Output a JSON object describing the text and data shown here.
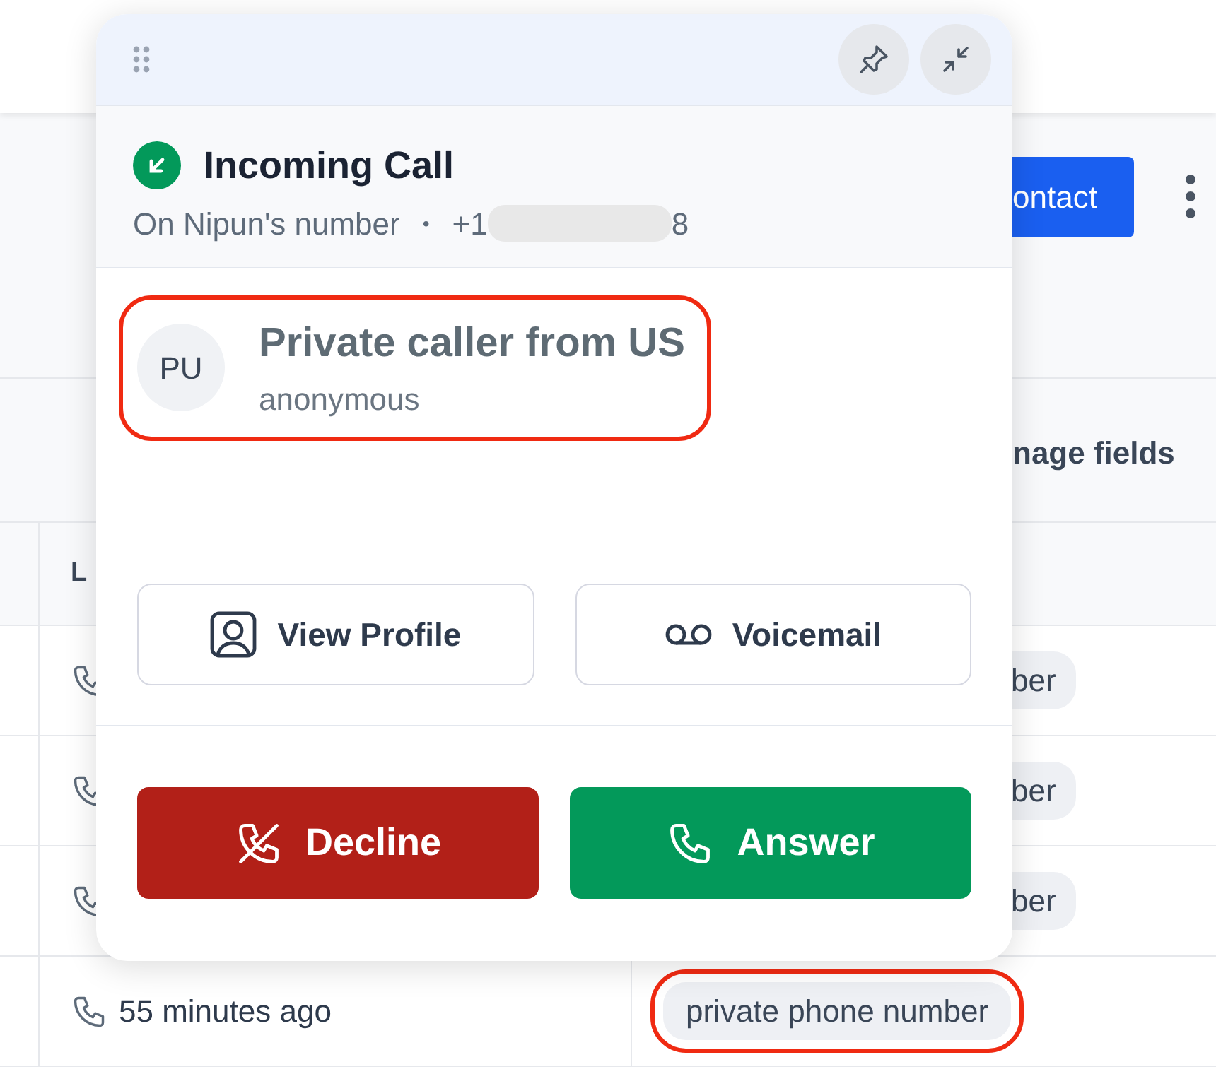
{
  "page": {
    "header_button": "ontact",
    "manage_fields": "nage fields",
    "table": {
      "column_header": "L",
      "rows": [
        {
          "tag": "ber",
          "highlighted": false
        },
        {
          "tag": "ber",
          "highlighted": false
        },
        {
          "tag": "ber",
          "highlighted": false
        },
        {
          "time": "55 minutes ago",
          "tag": "private phone number",
          "highlighted": true
        }
      ]
    }
  },
  "call_popup": {
    "title": "Incoming Call",
    "line": "On Nipun's number",
    "separator": "•",
    "number_start": "+1",
    "number_end": "8",
    "caller": {
      "initials": "PU",
      "name": "Private caller from US",
      "subtitle": "anonymous",
      "highlighted": true
    },
    "secondary_buttons": [
      {
        "label": "View Profile",
        "kind": "profile"
      },
      {
        "label": "Voicemail",
        "kind": "voicemail"
      }
    ],
    "actions": [
      {
        "label": "Decline",
        "kind": "decline"
      },
      {
        "label": "Answer",
        "kind": "answer"
      }
    ]
  }
}
